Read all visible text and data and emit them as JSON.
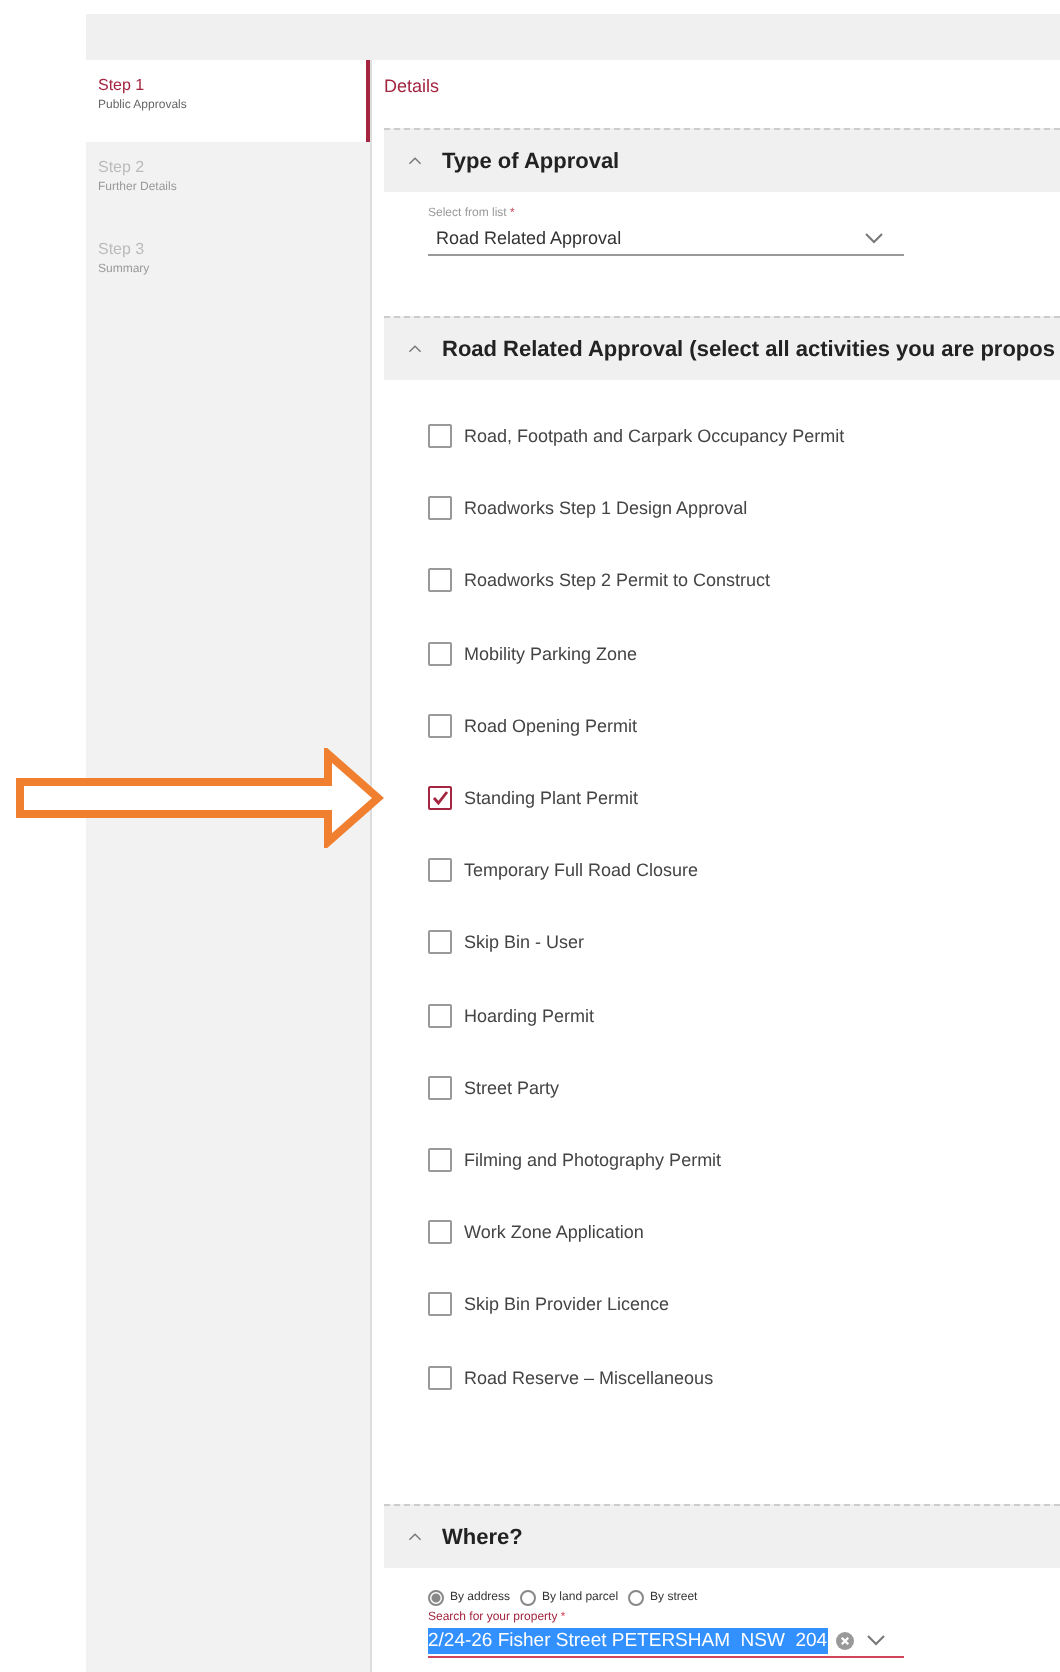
{
  "steps": [
    {
      "title": "Step 1",
      "subtitle": "Public Approvals",
      "selected": true
    },
    {
      "title": "Step 2",
      "subtitle": "Further Details",
      "selected": false
    },
    {
      "title": "Step 3",
      "subtitle": "Summary",
      "selected": false
    }
  ],
  "details_tab": "Details",
  "sections": [
    {
      "kind": "select",
      "title": "Type of Approval",
      "expanded": true,
      "label": "Select from list",
      "required_mark": "*",
      "value": "Road Related Approval"
    },
    {
      "kind": "checklist",
      "title": "Road Related Approval (select all activities you are propos",
      "expanded": true,
      "items": [
        {
          "label": "Road, Footpath and Carpark Occupancy Permit",
          "checked": false
        },
        {
          "label": "Roadworks Step 1 Design Approval",
          "checked": false
        },
        {
          "label": "Roadworks Step 2 Permit to Construct",
          "checked": false
        },
        {
          "label": "Mobility Parking Zone",
          "checked": false
        },
        {
          "label": "Road Opening Permit",
          "checked": false
        },
        {
          "label": "Standing Plant Permit",
          "checked": true,
          "pointed": true
        },
        {
          "label": "Temporary Full Road Closure",
          "checked": false
        },
        {
          "label": "Skip Bin - User",
          "checked": false
        },
        {
          "label": "Hoarding Permit",
          "checked": false
        },
        {
          "label": "Street Party",
          "checked": false
        },
        {
          "label": "Filming and Photography Permit",
          "checked": false
        },
        {
          "label": "Work Zone Application",
          "checked": false
        },
        {
          "label": "Skip Bin Provider Licence",
          "checked": false
        },
        {
          "label": "Road Reserve – Miscellaneous",
          "checked": false
        }
      ]
    },
    {
      "kind": "address",
      "title": "Where?",
      "expanded": true,
      "options": [
        {
          "label": "By address",
          "selected": true
        },
        {
          "label": "By land parcel",
          "selected": false
        },
        {
          "label": "By street",
          "selected": false
        }
      ],
      "label": "Search for your property",
      "required_mark": "*",
      "value": "2/24-26 Fisher Street PETERSHAM  NSW  204"
    }
  ],
  "annotation": {
    "kind": "arrow"
  }
}
